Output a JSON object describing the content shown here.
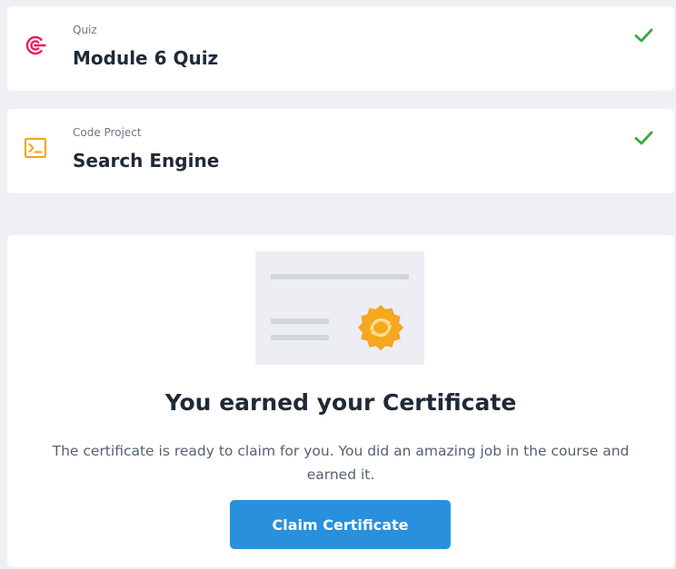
{
  "lessons": [
    {
      "type": "Quiz",
      "title": "Module 6 Quiz",
      "icon": "target-icon",
      "icon_color": "#e81e63",
      "completed": true
    },
    {
      "type": "Code Project",
      "title": "Search Engine",
      "icon": "terminal-icon",
      "icon_color": "#f5a623",
      "completed": true
    }
  ],
  "certificate": {
    "heading": "You earned your Certificate",
    "description": "The certificate is ready to claim for you. You did an amazing job in the course and earned it.",
    "button_label": "Claim Certificate",
    "button_color": "#2890dd",
    "badge_color": "#f5a623"
  },
  "colors": {
    "check": "#3aa93a",
    "background": "#eef0f4"
  }
}
